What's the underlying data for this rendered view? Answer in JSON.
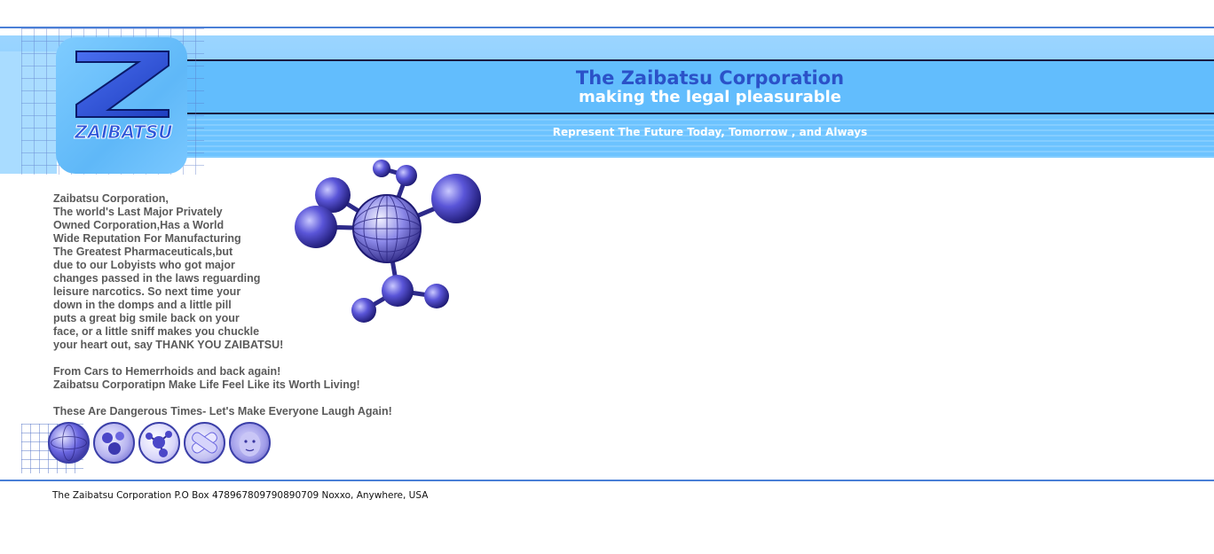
{
  "header": {
    "logo_text": "ZAIBATSU",
    "title": "The Zaibatsu Corporation",
    "tagline": "making the legal pleasurable",
    "motto": "Represent The Future Today, Tomorrow , and Always"
  },
  "main": {
    "paragraph_lines": [
      "Zaibatsu Corporation,",
      "The world's Last Major Privately",
      "Owned Corporation,Has a World",
      "Wide Reputation For Manufacturing",
      "The Greatest Pharmaceuticals,but",
      "due to our Lobyists who got major",
      "changes passed in the laws reguarding",
      "leisure narcotics. So next time your",
      "down in the domps and a little pill",
      "puts a great big smile back on your",
      "face, or a little sniff makes you chuckle",
      "your heart out, say THANK YOU ZAIBATSU!"
    ],
    "slogan_lines": [
      "From Cars to Hemerrhoids and back again!",
      "Zaibatsu Corporatipn Make Life Feel Like its Worth Living!"
    ],
    "closing": "These Are Dangerous Times- Let's Make Everyone Laugh Again!"
  },
  "icons": [
    "globe-icon",
    "pills-icon",
    "molecule-icon",
    "bandage-icon",
    "baby-face-icon"
  ],
  "footer": {
    "address": "The Zaibatsu Corporation  P.O Box 478967809790890709 Noxxo, Anywhere, USA"
  },
  "colors": {
    "accent_blue": "#2b52c8",
    "band_light": "#9bd5ff",
    "band_mid": "#62bdfd",
    "rule": "#4a7fd6",
    "body_text": "#5a5a5a"
  }
}
